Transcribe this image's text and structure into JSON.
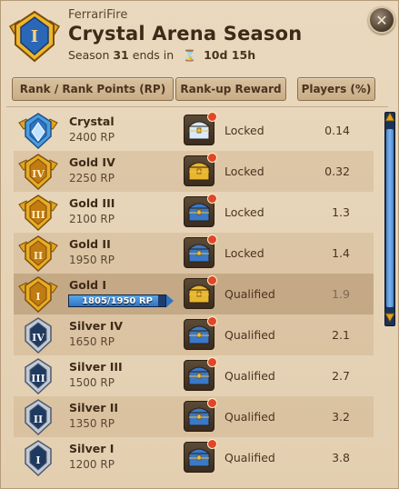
{
  "header": {
    "player_name": "FerrariFire",
    "title": "Crystal Arena Season",
    "season_label": "Season",
    "season_number": "31",
    "ends_in_label": "ends in",
    "timer": "10d 15h",
    "badge_icon": "gold-one-rank-icon",
    "close_icon": "close-icon"
  },
  "tabs": {
    "rank": "Rank / Rank Points (RP)",
    "reward": "Rank-up Reward",
    "players": "Players (%)"
  },
  "colors": {
    "crystal": "#4a9ee0",
    "gold": "#d8a020",
    "silver": "#8a96a8",
    "progress": "#3d8ad8"
  },
  "rows": [
    {
      "name": "Crystal",
      "rp": "2400 RP",
      "status": "Locked",
      "pct": "0.14",
      "tier": "crystal",
      "numeral": "",
      "chest": "crystal"
    },
    {
      "name": "Gold IV",
      "rp": "2250 RP",
      "status": "Locked",
      "pct": "0.32",
      "tier": "gold",
      "numeral": "IV",
      "chest": "gold"
    },
    {
      "name": "Gold III",
      "rp": "2100 RP",
      "status": "Locked",
      "pct": "1.3",
      "tier": "gold",
      "numeral": "III",
      "chest": "blue"
    },
    {
      "name": "Gold II",
      "rp": "1950 RP",
      "status": "Locked",
      "pct": "1.4",
      "tier": "gold",
      "numeral": "II",
      "chest": "blue"
    },
    {
      "name": "Gold I",
      "rp": "",
      "status": "Qualified",
      "pct": "1.9",
      "tier": "gold",
      "numeral": "I",
      "chest": "gold",
      "progress": {
        "text": "1805/1950 RP",
        "value": 1805,
        "max": 1950
      }
    },
    {
      "name": "Silver IV",
      "rp": "1650 RP",
      "status": "Qualified",
      "pct": "2.1",
      "tier": "silver",
      "numeral": "IV",
      "chest": "blue"
    },
    {
      "name": "Silver III",
      "rp": "1500 RP",
      "status": "Qualified",
      "pct": "2.7",
      "tier": "silver",
      "numeral": "III",
      "chest": "blue"
    },
    {
      "name": "Silver II",
      "rp": "1350 RP",
      "status": "Qualified",
      "pct": "3.2",
      "tier": "silver",
      "numeral": "II",
      "chest": "blue"
    },
    {
      "name": "Silver I",
      "rp": "1200 RP",
      "status": "Qualified",
      "pct": "3.8",
      "tier": "silver",
      "numeral": "I",
      "chest": "blue"
    }
  ]
}
